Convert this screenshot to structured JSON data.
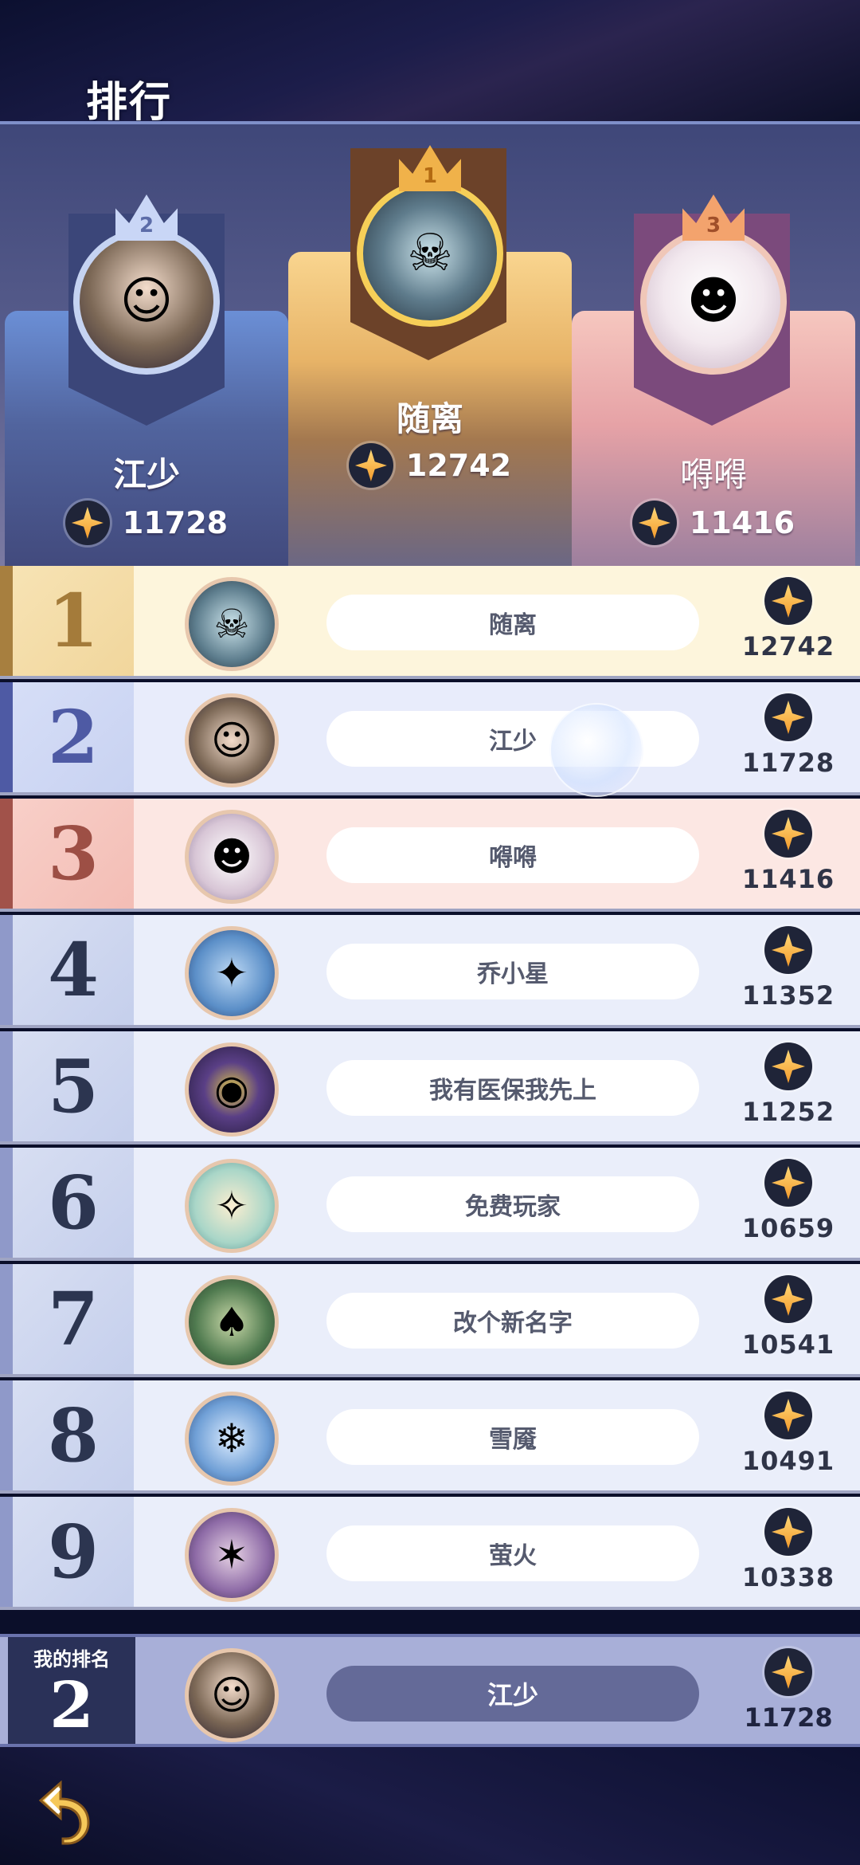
{
  "title": "排行",
  "podium": {
    "first": {
      "crown": "1",
      "name": "随离",
      "score": "12742",
      "avatar_icon": "skeleton-king-icon",
      "avatar_glyph": "☠"
    },
    "second": {
      "crown": "2",
      "name": "江少",
      "score": "11728",
      "avatar_icon": "dark-haired-hero-icon",
      "avatar_glyph": "☺"
    },
    "third": {
      "crown": "3",
      "name": "嘚嘚",
      "score": "11416",
      "avatar_icon": "white-hat-girl-icon",
      "avatar_glyph": "☻"
    }
  },
  "rows": [
    {
      "rank": "1",
      "name": "随离",
      "score": "12742",
      "avatar_icon": "skeleton-king-icon",
      "avatar_glyph": "☠",
      "avatar_color": "#5d7d8d"
    },
    {
      "rank": "2",
      "name": "江少",
      "score": "11728",
      "avatar_icon": "dark-haired-hero-icon",
      "avatar_glyph": "☺",
      "avatar_color": "#7c6856"
    },
    {
      "rank": "3",
      "name": "嘚嘚",
      "score": "11416",
      "avatar_icon": "white-hat-girl-icon",
      "avatar_glyph": "☻",
      "avatar_color": "#d8c6d6"
    },
    {
      "rank": "4",
      "name": "乔小星",
      "score": "11352",
      "avatar_icon": "blue-dragon-icon",
      "avatar_glyph": "✦",
      "avatar_color": "#5b8fc8"
    },
    {
      "rank": "5",
      "name": "我有医保我先上",
      "score": "11252",
      "avatar_icon": "purple-eye-icon",
      "avatar_glyph": "◉",
      "avatar_color": "#5a3f86"
    },
    {
      "rank": "6",
      "name": "免费玩家",
      "score": "10659",
      "avatar_icon": "elf-knight-icon",
      "avatar_glyph": "✧",
      "avatar_color": "#a9d6c8"
    },
    {
      "rank": "7",
      "name": "改个新名字",
      "score": "10541",
      "avatar_icon": "green-hat-ogre-icon",
      "avatar_glyph": "♠",
      "avatar_color": "#4f7a4f"
    },
    {
      "rank": "8",
      "name": "雪魇",
      "score": "10491",
      "avatar_icon": "ice-beast-icon",
      "avatar_glyph": "❄",
      "avatar_color": "#6f9fd6"
    },
    {
      "rank": "9",
      "name": "萤火",
      "score": "10338",
      "avatar_icon": "purple-hair-warrior-icon",
      "avatar_glyph": "✶",
      "avatar_color": "#8d6aa6"
    }
  ],
  "my_rank": {
    "label": "我的排名",
    "rank": "2",
    "name": "江少",
    "score": "11728",
    "avatar_icon": "dark-haired-hero-icon",
    "avatar_glyph": "☺"
  },
  "back_icon": "back-arrow-icon",
  "currency_icon": "star-coin-icon"
}
